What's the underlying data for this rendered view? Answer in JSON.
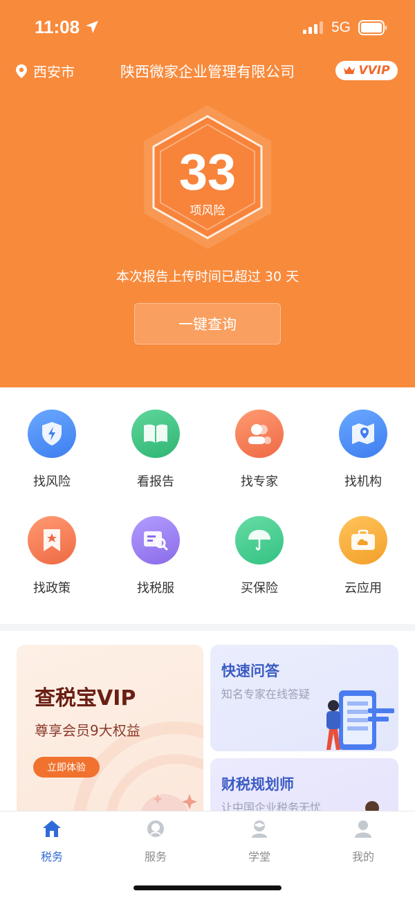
{
  "status": {
    "time": "11:08",
    "network": "5G"
  },
  "header": {
    "city": "西安市",
    "company": "陕西微家企业管理有限公司",
    "vip_badge": "VVIP",
    "risk_count": "33",
    "risk_label": "项风险",
    "notice": "本次报告上传时间已超过 30 天",
    "query_button": "一键查询"
  },
  "grid": {
    "items": [
      {
        "label": "找风险",
        "icon": "shield-icon",
        "color": "#4a8cf6"
      },
      {
        "label": "看报告",
        "icon": "book-icon",
        "color": "#3fbf7f"
      },
      {
        "label": "找专家",
        "icon": "expert-icon",
        "color": "#f0714a"
      },
      {
        "label": "找机构",
        "icon": "map-pin-icon",
        "color": "#4a8cf6"
      },
      {
        "label": "找政策",
        "icon": "policy-bookmark-icon",
        "color": "#f0714a"
      },
      {
        "label": "找税服",
        "icon": "tax-search-icon",
        "color": "#9b7cf0"
      },
      {
        "label": "买保险",
        "icon": "umbrella-icon",
        "color": "#3fc98a"
      },
      {
        "label": "云应用",
        "icon": "cloud-case-icon",
        "color": "#f6aa38"
      }
    ]
  },
  "cards": {
    "vip": {
      "title": "查税宝VIP",
      "subtitle": "尊享会员9大权益",
      "button": "立即体验"
    },
    "qa": {
      "title": "快速问答",
      "subtitle": "知名专家在线答疑"
    },
    "planner": {
      "title": "财税规划师",
      "subtitle": "让中国企业税务无忧"
    }
  },
  "tabs": [
    {
      "label": "税务",
      "icon": "home-icon",
      "active": true
    },
    {
      "label": "服务",
      "icon": "service-icon",
      "active": false
    },
    {
      "label": "学堂",
      "icon": "school-icon",
      "active": false
    },
    {
      "label": "我的",
      "icon": "profile-icon",
      "active": false
    }
  ],
  "colors": {
    "header": "#f88a3c",
    "accent_blue": "#2f6bd8",
    "vip_orange": "#f0722e"
  }
}
